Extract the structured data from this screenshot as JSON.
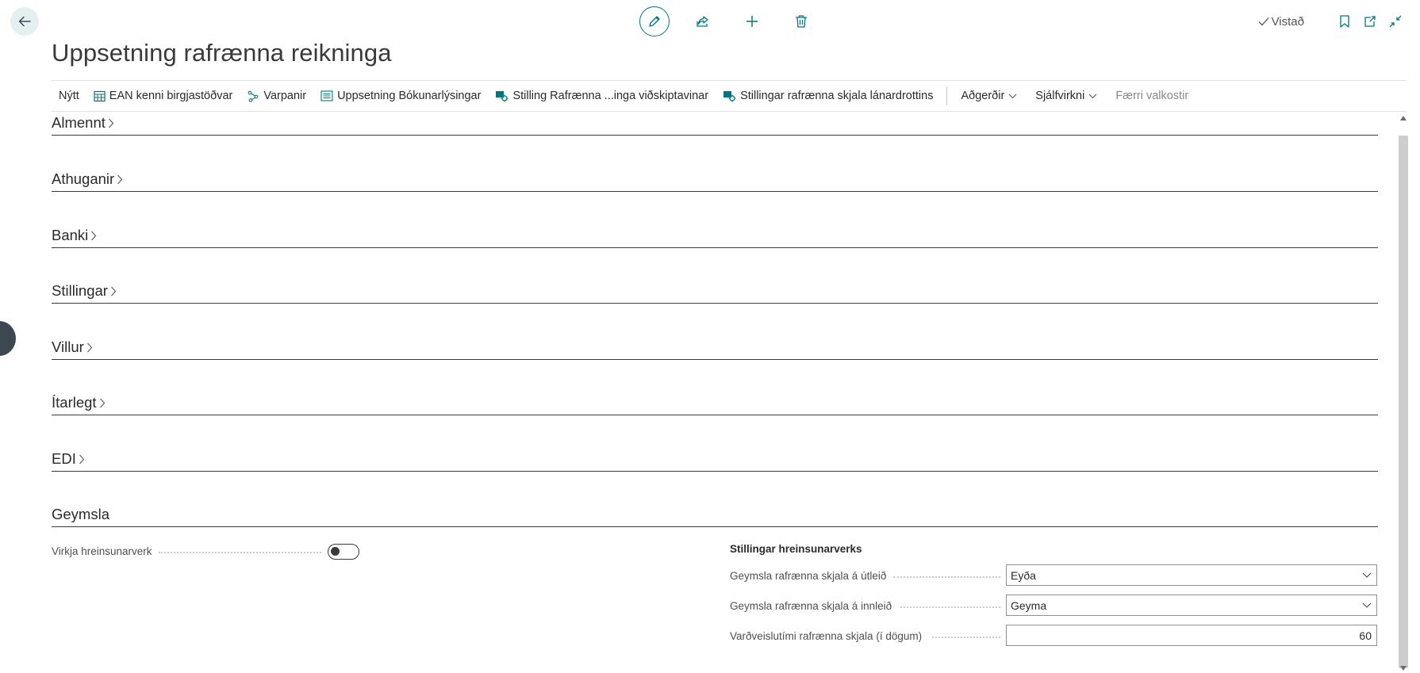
{
  "page": {
    "title": "Uppsetning rafrænna reikninga"
  },
  "header": {
    "saved_label": "Vistað"
  },
  "action_bar": {
    "items": [
      {
        "label": "Nýtt",
        "icon": "none"
      },
      {
        "label": "EAN kenni birgjastöðvar",
        "icon": "calendar-grid-icon"
      },
      {
        "label": "Varpanir",
        "icon": "mapping-icon"
      },
      {
        "label": "Uppsetning Bókunarlýsingar",
        "icon": "list-icon"
      },
      {
        "label": "Stilling Rafrænna ...inga viðskiptavinar",
        "icon": "settings-people-icon"
      },
      {
        "label": "Stillingar rafrænna skjala lánardrottins",
        "icon": "settings-people-icon"
      }
    ],
    "menus": [
      {
        "label": "Aðgerðir"
      },
      {
        "label": "Sjálfvirkni"
      }
    ],
    "fewer_label": "Færri valkostir"
  },
  "sections": [
    {
      "title": "Almennt",
      "collapsed": true
    },
    {
      "title": "Athuganir",
      "collapsed": true
    },
    {
      "title": "Banki",
      "collapsed": true
    },
    {
      "title": "Stillingar",
      "collapsed": true
    },
    {
      "title": "Villur",
      "collapsed": true
    },
    {
      "title": "Ítarlegt",
      "collapsed": true
    },
    {
      "title": "EDI",
      "collapsed": true
    },
    {
      "title": "Geymsla",
      "collapsed": false
    }
  ],
  "geymsla": {
    "enable_label": "Virkja hreinsunarverk",
    "enable_value": false,
    "group_title": "Stillingar hreinsunarverks",
    "outbound_label": "Geymsla rafrænna skjala á útleið",
    "outbound_value": "Eyða",
    "inbound_label": "Geymsla rafrænna skjala á innleið",
    "inbound_value": "Geyma",
    "retention_label": "Varðveislutími rafrænna skjala (í dögum)",
    "retention_value": "60"
  },
  "colors": {
    "accent": "#00777f",
    "text": "#212121"
  }
}
